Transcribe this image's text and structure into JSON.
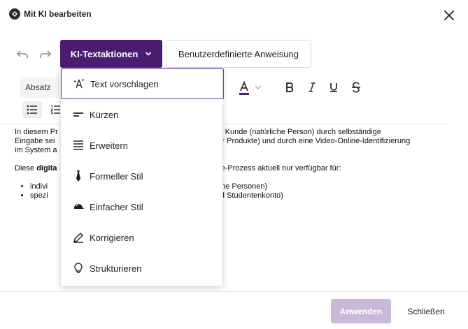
{
  "dialog": {
    "title": "Mit KI bearbeiten"
  },
  "toolbar": {
    "ki_label": "KI-Textaktionen",
    "custom_label": "Benutzerdefinierte Anweisung",
    "paragraph_style": "Absatz"
  },
  "dropdown": {
    "items": [
      {
        "label": "Text vorschlagen",
        "icon": "sparkle-icon"
      },
      {
        "label": "Kürzen",
        "icon": "shorten-icon"
      },
      {
        "label": "Erweitern",
        "icon": "expand-icon"
      },
      {
        "label": "Formeller Stil",
        "icon": "tie-icon"
      },
      {
        "label": "Einfacher Stil",
        "icon": "cap-icon"
      },
      {
        "label": "Korrigieren",
        "icon": "pencil-icon"
      },
      {
        "label": "Strukturieren",
        "icon": "lightbulb-icon"
      }
    ]
  },
  "content": {
    "p1_line1_a": "In diesem Pr",
    "p1_line1_b": "ein neuer Kunde (natürliche Person) durch selbständige",
    "p1_line2_a": "Eingabe sei",
    "p1_line2_b": "ewählter Produkte) und durch eine Video-Online-Identifizierung",
    "p1_line3_a": "im System a",
    "p2_a": "Diese ",
    "p2_bold": "digita",
    "p2_b": "ne-Prozess aktuell nur verfügbar für:",
    "li1_a": "indivi",
    "li1_b": "stische Personen)",
    "li2_a": "spezi",
    "li2_b": "und Studentenkonto)"
  },
  "footer": {
    "apply_label": "Anwenden",
    "close_label": "Schließen"
  },
  "colors": {
    "accent": "#4b1d72",
    "accent_disabled": "#c9b8d8",
    "active_border": "#6a3c96"
  }
}
